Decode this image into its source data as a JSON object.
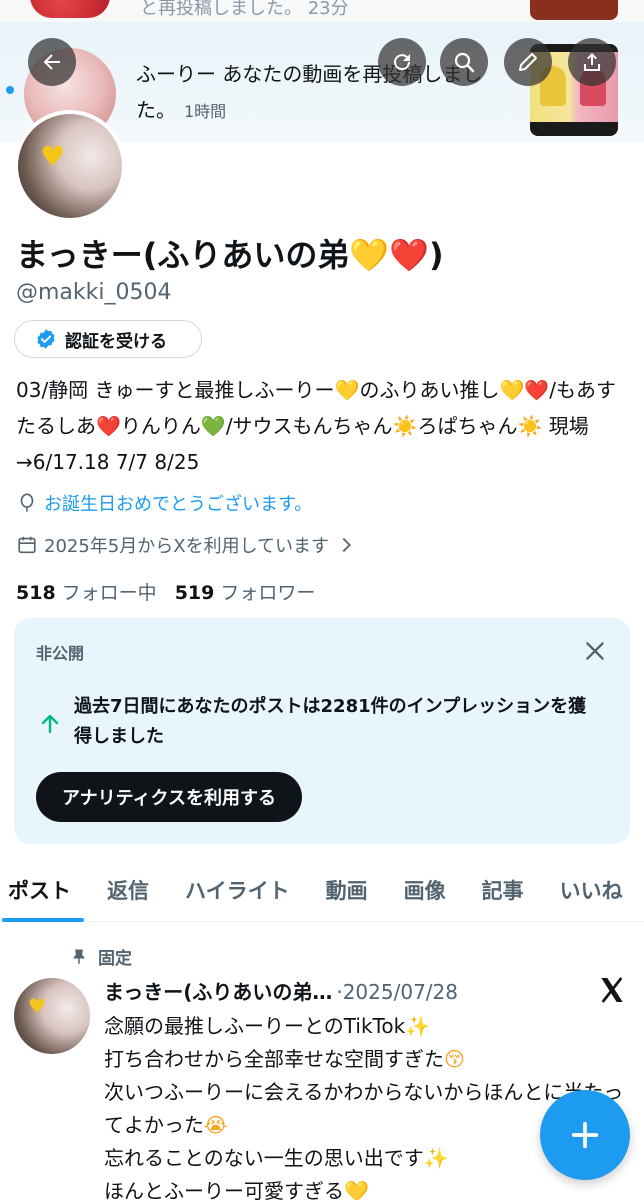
{
  "top_strip": {
    "text": "と再投稿しました。 23分"
  },
  "notification": {
    "text": "ふーりー あなたの動画を再投稿しました。",
    "time": "1時間"
  },
  "header_icons": [
    "back-arrow-icon",
    "refresh-icon",
    "search-icon",
    "edit-icon",
    "share-icon"
  ],
  "profile": {
    "name": "まっきー(ふりあいの弟",
    "name_emoji_1": "💛",
    "name_emoji_2": "❤️",
    "name_close": ")",
    "handle": "@makki_0504",
    "verify_button": "認証を受ける",
    "bio": {
      "p1": "03/静岡 きゅーすと最推しふーりー",
      "e1": "💛",
      "p2": "のふりあい推し",
      "e2": "💛",
      "e3": "❤️",
      "p3": "/もあすたるしあ",
      "e4": "❤️",
      "p4": "りんりん",
      "e5": "💚",
      "p5": "/サウスもんちゃん",
      "e6": "☀️",
      "p6": "ろぱちゃん",
      "e7": "☀️",
      "p7": " 現場→6/17.18 7/7 8/25"
    },
    "birthday": "お誕生日おめでとうございます。",
    "joined": "2025年5月からXを利用しています",
    "following_count": "518",
    "following_label": "フォロー中",
    "followers_count": "519",
    "followers_label": "フォロワー"
  },
  "analytics_card": {
    "private_label": "非公開",
    "message": "過去7日間にあなたのポストは2281件のインプレッションを獲得しました",
    "cta": "アナリティクスを利用する"
  },
  "tabs": [
    {
      "label": "ポスト",
      "active": true
    },
    {
      "label": "返信"
    },
    {
      "label": "ハイライト"
    },
    {
      "label": "動画"
    },
    {
      "label": "画像"
    },
    {
      "label": "記事"
    },
    {
      "label": "いいね"
    }
  ],
  "pinned_post": {
    "pin_label": "固定",
    "name": "まっきー(ふりあいの弟…",
    "date": "·2025/07/28",
    "line1": "念願の最推しふーりーとのTikTok",
    "line1_emoji": "✨",
    "line2": "打ち合わせから全部幸せな空間すぎた",
    "line2_emoji": "😚",
    "line3": "次いつふーりーに会えるかわからないからほんとに当たってよかった",
    "line3_emoji": "😭",
    "line4": "忘れることのない一生の思い出です",
    "line4_emoji": "✨",
    "line5": "ほんとふーりー可愛すぎる",
    "line5_emoji": "💛"
  },
  "colors": {
    "accent": "#1d9bf0",
    "text_primary": "#0f1419",
    "text_secondary": "#536471",
    "card_bg": "#e8f5fd"
  }
}
